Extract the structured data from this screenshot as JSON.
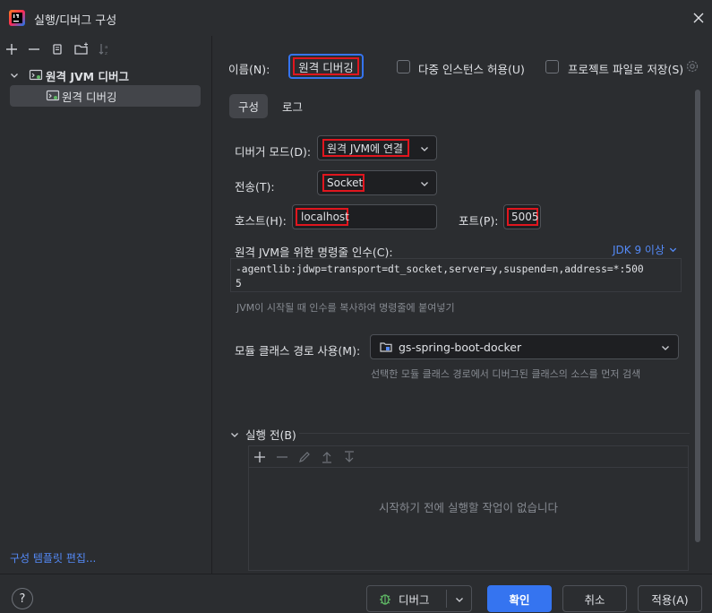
{
  "window": {
    "title": "실행/디버그 구성",
    "close_icon": "close-icon"
  },
  "toolbar": {
    "icons": [
      "add-icon",
      "remove-icon",
      "copy-icon",
      "folder-icon",
      "sort-icon"
    ]
  },
  "tree": {
    "parent_label": "원격 JVM 디버그",
    "child_label": "원격 디버깅"
  },
  "left_footer": {
    "edit_templates": "구성 템플릿 편집..."
  },
  "form": {
    "name_label": "이름(N):",
    "name_value": "원격 디버깅",
    "allow_multiple_label": "다중 인스턴스 허용(U)",
    "save_to_project_label": "프로젝트 파일로 저장(S)",
    "tabs": [
      "구성",
      "로그"
    ],
    "debugger_mode_label": "디버거 모드(D):",
    "debugger_mode_value": "원격 JVM에 연결",
    "transport_label": "전송(T):",
    "transport_value": "Socket",
    "host_label": "호스트(H):",
    "host_value": "localhost",
    "port_label": "포트(P):",
    "port_value": "5005",
    "cmd_args_label": "원격 JVM을 위한 명령줄 인수(C):",
    "jdk_version": "JDK 9 이상",
    "cmd_args_value_line1": "-agentlib:jdwp=transport=dt_socket,server=y,suspend=n,address=*:500",
    "cmd_args_value_line2": "5",
    "cmd_args_hint": "JVM이 시작될 때 인수를 복사하여 명령줄에 붙여넣기",
    "module_label": "모듈 클래스 경로 사용(M):",
    "module_value": "gs-spring-boot-docker",
    "module_hint": "선택한 모듈 클래스 경로에서 디버그된 클래스의 소스를 먼저 검색",
    "before_launch_label": "실행 전(B)",
    "before_launch_empty": "시작하기 전에 실행할 작업이 없습니다"
  },
  "footer": {
    "help": "?",
    "debug": "디버그",
    "ok": "확인",
    "cancel": "취소",
    "apply": "적용(A)"
  },
  "colors": {
    "background": "#2b2d30",
    "input_bg": "#1e1f22",
    "accent": "#3574f0",
    "highlight_red": "#e0161e",
    "link": "#548af7"
  }
}
